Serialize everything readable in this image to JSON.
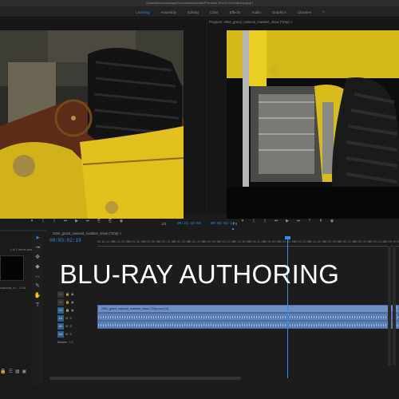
{
  "window": {
    "path": "/Users/benuhnoeayer/Documents/Adobe/Premiere Pro/11.0/Untitled.prproj *"
  },
  "workspaces": {
    "tabs": [
      "Learning",
      "Assembly",
      "Editing",
      "Color",
      "Effects",
      "Audio",
      "Graphics",
      "Libraries"
    ],
    "active_index": 0,
    "more": "»"
  },
  "source_monitor": {
    "zoom": "1/2",
    "timecode": "00:31:33:03"
  },
  "program_monitor": {
    "title": "Program: 2004_grand_national_roadster_show (720p) ≡",
    "timecode_left": "00:03:02:19",
    "zoom": "Fit"
  },
  "project_panel": {
    "items_label": "1 of 2 items selected",
    "clip_label": "national_ro... 3:18"
  },
  "timeline": {
    "sequence_title": "2004_grand_national_roadster_show (720p) ≡",
    "timecode": "00:03:02:19",
    "ruler": [
      "00:01:15:00",
      "00:01:30:00",
      "00:01:45:00",
      "00:02:00:00",
      "00:02:15:00",
      "00:02:30:00",
      "00:02:45:00",
      "00:03:00:00",
      "00:03:15:00",
      "00:03:30:00",
      "00:03:45:00",
      "00:04:00:00",
      "00:04:15:00",
      "00:04:30:00",
      "00:04:45:00",
      "00:05:00:00",
      "00:05:15:00",
      "00:05:30:00",
      "00:05:45:00",
      "00:06:00:00"
    ],
    "tracks": [
      {
        "id": "V3"
      },
      {
        "id": "V2"
      },
      {
        "id": "V1"
      },
      {
        "id": "A1"
      },
      {
        "id": "A2"
      },
      {
        "id": "A3"
      }
    ],
    "master_label": "Master",
    "master_value": "0.0",
    "clip_video": "2004_grand_national_roadster_show (720p).mov [V]",
    "clip_audio": "2004_grand_national_roadster_show (720p).mov [A]"
  },
  "overlay": {
    "title": "BLU-RAY AUTHORING"
  },
  "colors": {
    "accent": "#2e8ff0",
    "clip": "#6f8fc2"
  }
}
